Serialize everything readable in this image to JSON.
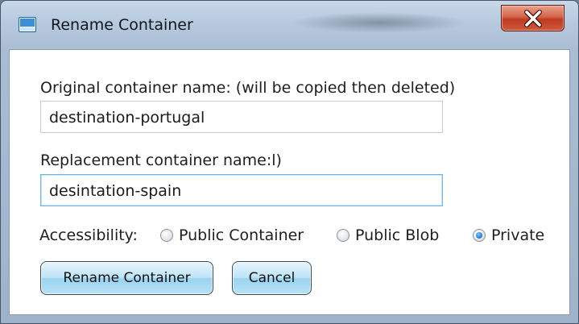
{
  "window": {
    "title": "Rename Container",
    "icon": "window-app-icon",
    "close_icon": "close-icon"
  },
  "form": {
    "original": {
      "label": "Original container name: (will be copied then deleted)",
      "value": "destination-portugal"
    },
    "replacement": {
      "label": "Replacement container name:l)",
      "value": "desintation-spain"
    },
    "accessibility": {
      "label": "Accessibility:",
      "options": [
        {
          "label": "Public Container",
          "checked": false
        },
        {
          "label": "Public Blob",
          "checked": false
        },
        {
          "label": "Private",
          "checked": true
        }
      ]
    }
  },
  "buttons": {
    "rename_label": "Rename Container",
    "cancel_label": "Cancel"
  },
  "colors": {
    "button_fill": "#bfe4f7",
    "close_button": "#d4634a",
    "radio_selected": "#2a7fd6",
    "focus_border": "#6fb4e4"
  }
}
